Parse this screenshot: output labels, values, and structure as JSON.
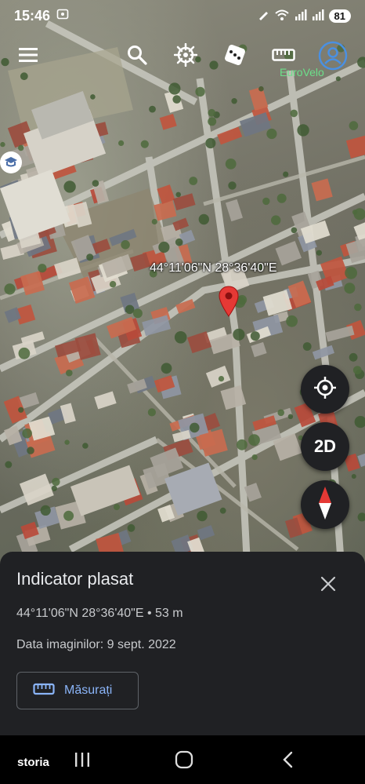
{
  "status_bar": {
    "time": "15:46",
    "battery": "81",
    "icons": [
      "screenshot-icon",
      "pen-icon",
      "wifi-icon",
      "signal-icon",
      "signal-icon"
    ]
  },
  "toolbar": {
    "items": [
      "menu-icon",
      "search-icon",
      "voyager-wheel-icon",
      "dice-icon",
      "ruler-icon",
      "account-icon"
    ],
    "account_label": "EuroVelo"
  },
  "map": {
    "overlay_coordinates": "44°11'06\"N 28°36'40\"E",
    "marker_color": "#e53935"
  },
  "controls": {
    "locate": "my-location-icon",
    "view_mode": "2D",
    "compass": "compass-icon"
  },
  "sheet": {
    "title": "Indicator plasat",
    "coordinates_line": "44°11'06\"N 28°36'40\"E • 53 m",
    "imagery_date": "Data imaginilor: 9 sept. 2022",
    "measure_label": "Măsurați"
  },
  "navbar": {
    "brand": "storia"
  },
  "colors": {
    "sheet_bg": "#202124",
    "accent_blue": "#8ab4f8",
    "eurovelo_green": "#6be08a"
  }
}
